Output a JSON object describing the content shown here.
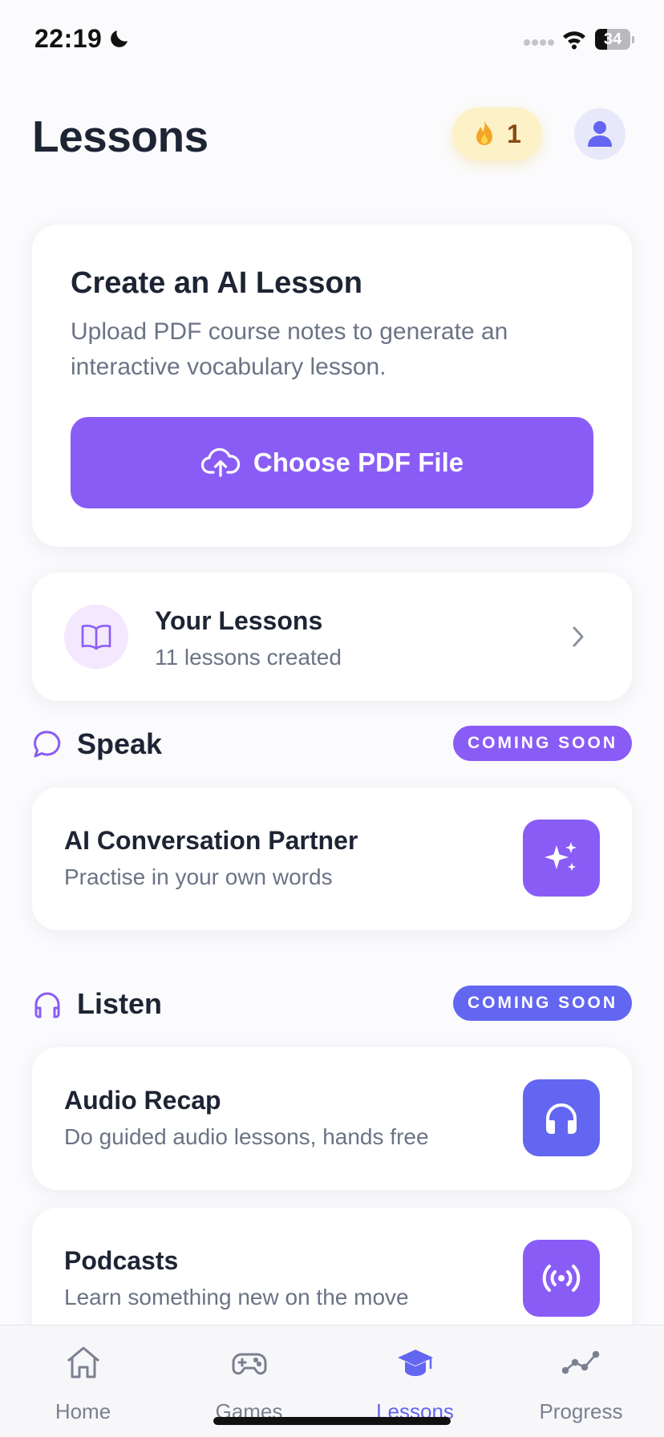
{
  "status_bar": {
    "time": "22:19",
    "battery": "34",
    "battery_level": 0.34
  },
  "header": {
    "title": "Lessons",
    "streak_count": "1"
  },
  "create_card": {
    "title": "Create an AI Lesson",
    "description": "Upload PDF course notes to generate an interactive vocabulary lesson.",
    "button_label": "Choose PDF File"
  },
  "your_lessons": {
    "title": "Your Lessons",
    "subtitle": "11 lessons created"
  },
  "speak_section": {
    "title": "Speak",
    "badge": "COMING SOON",
    "items": [
      {
        "title": "AI Conversation Partner",
        "subtitle": "Practise in your own words",
        "icon": "sparkles-icon"
      }
    ]
  },
  "listen_section": {
    "title": "Listen",
    "badge": "COMING SOON",
    "items": [
      {
        "title": "Audio Recap",
        "subtitle": "Do guided audio lessons, hands free",
        "icon": "headphones-icon"
      },
      {
        "title": "Podcasts",
        "subtitle": "Learn something new on the move",
        "icon": "broadcast-icon"
      }
    ]
  },
  "tab_bar": {
    "active": "Lessons",
    "tabs": [
      {
        "label": "Home",
        "icon": "home-icon"
      },
      {
        "label": "Games",
        "icon": "gamepad-icon"
      },
      {
        "label": "Lessons",
        "icon": "graduation-cap-icon"
      },
      {
        "label": "Progress",
        "icon": "trend-line-icon"
      }
    ]
  },
  "colors": {
    "accent_purple": "#8a5cf6",
    "accent_indigo": "#6366f1",
    "streak_bg": "#fdf1c7",
    "text_primary": "#1d2433",
    "text_secondary": "#6b7385"
  }
}
